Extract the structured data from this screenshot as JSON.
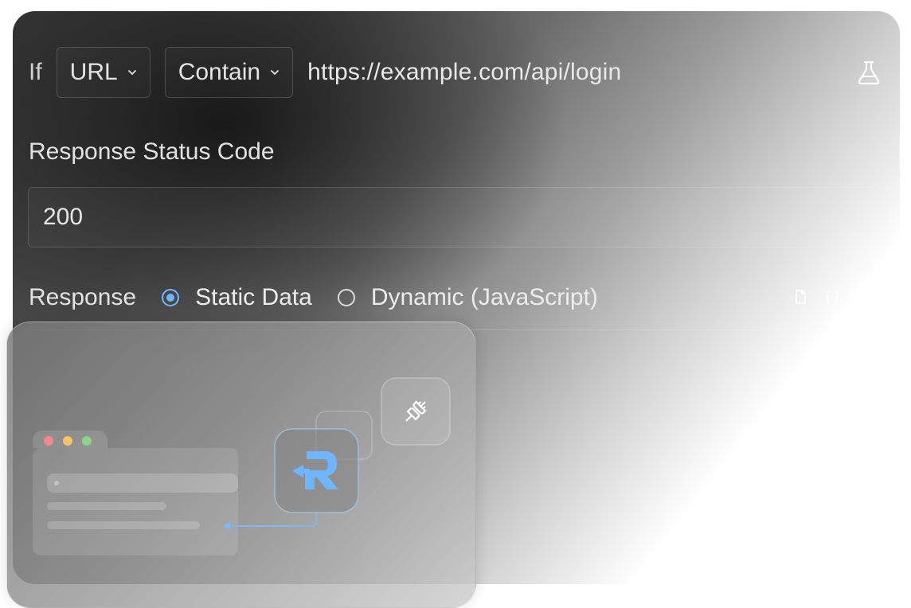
{
  "rule": {
    "if_label": "If",
    "match_field": "URL",
    "operator": "Contain",
    "url_value": "https://example.com/api/login"
  },
  "status": {
    "label": "Response Status Code",
    "value": "200"
  },
  "response": {
    "label": "Response",
    "options": [
      {
        "label": "Static Data",
        "selected": true
      },
      {
        "label": "Dynamic (JavaScript)",
        "selected": false
      }
    ]
  },
  "colors": {
    "accent": "#6fb5ff",
    "traffic_red": "#f08a8a",
    "traffic_yellow": "#f2c46b",
    "traffic_green": "#8fd18f"
  },
  "icons": {
    "test": "flask-icon",
    "copy": "copy-icon",
    "format": "braces-icon",
    "expand": "expand-icon",
    "plugin": "plug-icon",
    "logo": "requestly-logo-icon"
  }
}
